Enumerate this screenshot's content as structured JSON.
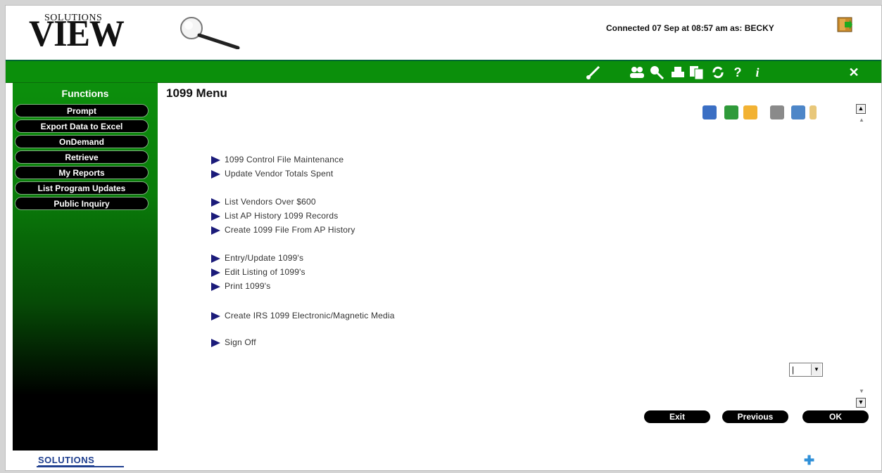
{
  "header": {
    "logo_small": "SOLUTIONS",
    "logo_big": "VIEW",
    "connection_status": "Connected 07 Sep at 08:57 am as: BECKY"
  },
  "toolbar_icons": [
    "brush-icon",
    "users-icon",
    "search-icon",
    "print-icon",
    "copy-icon",
    "refresh-icon",
    "help-icon",
    "info-icon",
    "close-icon"
  ],
  "sidebar": {
    "title": "Functions",
    "items": [
      {
        "label": "Prompt"
      },
      {
        "label": "Export Data to Excel"
      },
      {
        "label": "OnDemand"
      },
      {
        "label": "Retrieve"
      },
      {
        "label": "My Reports"
      },
      {
        "label": "List Program Updates"
      },
      {
        "label": "Public Inquiry"
      }
    ]
  },
  "main": {
    "title": "1099 Menu",
    "menu_items": [
      {
        "label": "1099 Control File Maintenance"
      },
      {
        "label": "Update Vendor Totals Spent"
      },
      {
        "label": "List Vendors Over $600"
      },
      {
        "label": "List AP History 1099 Records"
      },
      {
        "label": "Create 1099 File From AP History"
      },
      {
        "label": "Entry/Update 1099's"
      },
      {
        "label": "Edit Listing of 1099's"
      },
      {
        "label": "Print 1099's"
      },
      {
        "label": "Create IRS 1099 Electronic/Magnetic Media"
      },
      {
        "label": "Sign Off"
      }
    ],
    "select_value": "|"
  },
  "buttons": {
    "exit": "Exit",
    "previous": "Previous",
    "ok": "OK"
  },
  "footer": {
    "logo": "SOLUTIONS"
  },
  "colors": {
    "topbar": "#0b8f0b",
    "arrow": "#1b1b7a",
    "footer_logo": "#1f3f8f",
    "plus": "#2e8fd8"
  }
}
